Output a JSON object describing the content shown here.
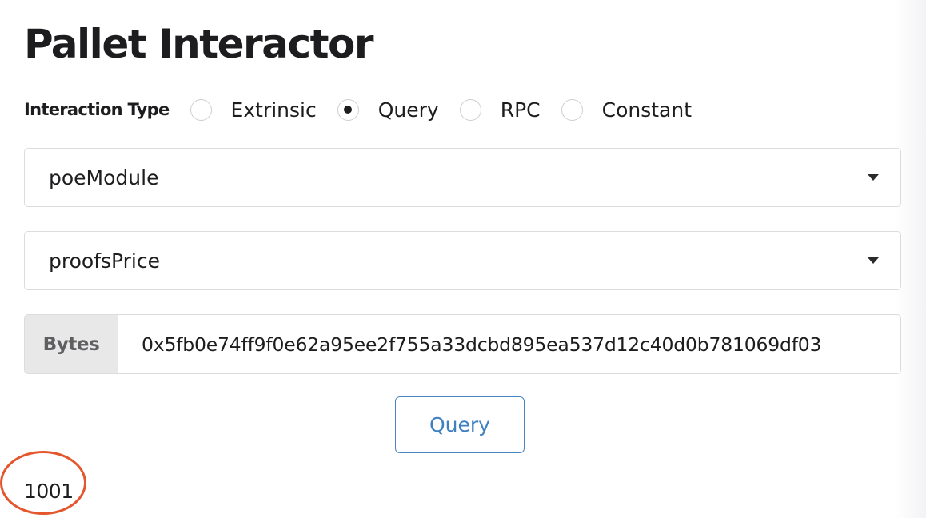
{
  "page": {
    "title": "Pallet Interactor"
  },
  "interaction": {
    "label": "Interaction Type",
    "options": [
      {
        "label": "Extrinsic",
        "checked": false
      },
      {
        "label": "Query",
        "checked": true
      },
      {
        "label": "RPC",
        "checked": false
      },
      {
        "label": "Constant",
        "checked": false
      }
    ]
  },
  "pallet_select": {
    "value": "poeModule"
  },
  "callable_select": {
    "value": "proofsPrice"
  },
  "param": {
    "label": "Bytes",
    "value": "0x5fb0e74ff9f0e62a95ee2f755a33dcbd895ea537d12c40d0b781069df03"
  },
  "submit": {
    "label": "Query"
  },
  "result": {
    "value": "1001"
  },
  "colors": {
    "button_accent": "#3f80c2",
    "annotation": "#e4572e",
    "label_bg": "#e8e8e8"
  }
}
